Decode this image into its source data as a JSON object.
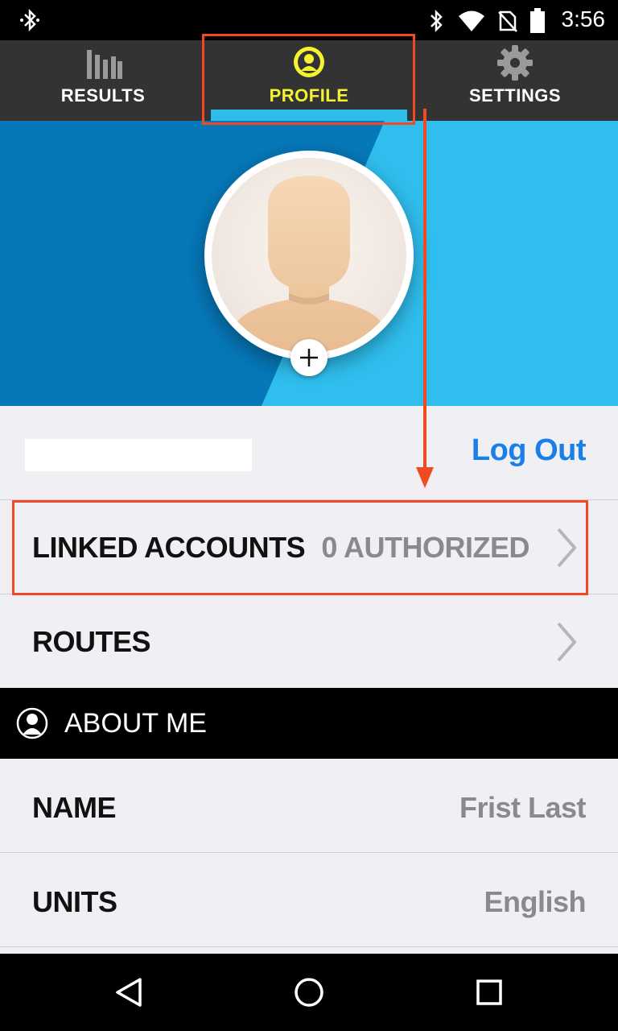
{
  "status_bar": {
    "time": "3:56",
    "icons": [
      "bluetooth-icon",
      "wifi-icon",
      "no-sim-icon",
      "battery-icon"
    ]
  },
  "tabs": [
    {
      "label": "RESULTS",
      "icon": "bar-chart-icon",
      "active": false
    },
    {
      "label": "PROFILE",
      "icon": "profile-icon",
      "active": true
    },
    {
      "label": "SETTINGS",
      "icon": "gear-icon",
      "active": false
    }
  ],
  "profile": {
    "username": "",
    "logout_label": "Log Out"
  },
  "rows": {
    "linked_accounts": {
      "label": "LINKED ACCOUNTS",
      "value": "0 AUTHORIZED"
    },
    "routes": {
      "label": "ROUTES"
    }
  },
  "about_me": {
    "header": "ABOUT ME",
    "name": {
      "label": "NAME",
      "value": "Frist Last"
    },
    "units": {
      "label": "UNITS",
      "value": "English"
    }
  },
  "colors": {
    "accent_yellow": "#f5f230",
    "accent_blue": "#2ebdea",
    "link_blue": "#1a7fe6",
    "annotation_red": "#f04a23",
    "hero_dark_blue": "#0677b8"
  }
}
